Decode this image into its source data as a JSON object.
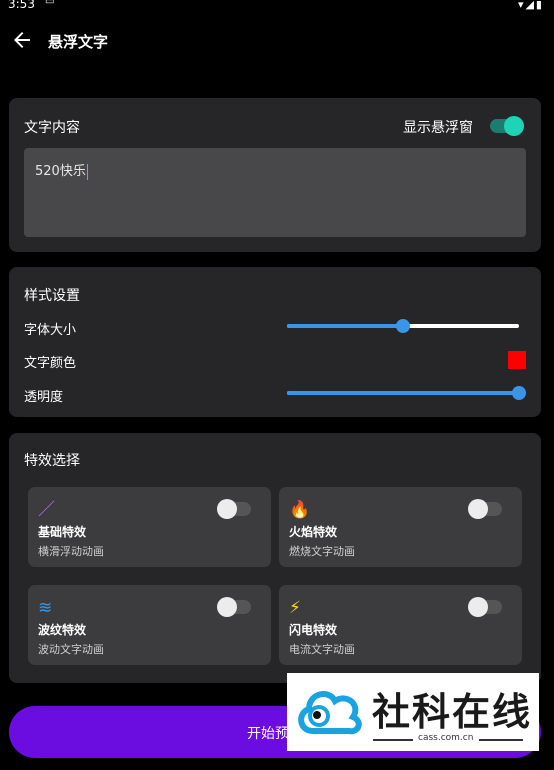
{
  "status_bar": {
    "time": "3:53",
    "indicators": "▾◢▮"
  },
  "app_bar": {
    "title": "悬浮文字",
    "back_icon": "arrow-left-icon"
  },
  "text_card": {
    "section_title": "文字内容",
    "toggle_label": "显示悬浮窗",
    "toggle_on": true,
    "input_value": "520快乐"
  },
  "style_card": {
    "section_title": "样式设置",
    "font_size_label": "字体大小",
    "font_size_fraction": 0.5,
    "color_label": "文字颜色",
    "color_value": "#ff0000",
    "opacity_label": "透明度",
    "opacity_fraction": 1.0
  },
  "effects_card": {
    "section_title": "特效选择",
    "items": [
      {
        "name": "基础特效",
        "desc": "横滑浮动动画",
        "icon": "magic-wand-icon",
        "icon_glyph": "／",
        "icon_color": "#b46cf0",
        "enabled": false
      },
      {
        "name": "火焰特效",
        "desc": "燃烧文字动画",
        "icon": "fire-icon",
        "icon_glyph": "🔥",
        "icon_color": "#ff7a1a",
        "enabled": false
      },
      {
        "name": "波纹特效",
        "desc": "波动文字动画",
        "icon": "waves-icon",
        "icon_glyph": "≋",
        "icon_color": "#3a95e8",
        "enabled": false
      },
      {
        "name": "闪电特效",
        "desc": "电流文字动画",
        "icon": "lightning-icon",
        "icon_glyph": "⚡",
        "icon_color": "#ffd21a",
        "enabled": false
      }
    ]
  },
  "start_button": {
    "label": "开始预"
  },
  "watermark": {
    "title": "社科在线",
    "url": "cass.com.cn"
  },
  "colors": {
    "accent_teal": "#1ed3b6",
    "slider_blue": "#3a95e8",
    "button_purple": "#6b0ce0"
  }
}
